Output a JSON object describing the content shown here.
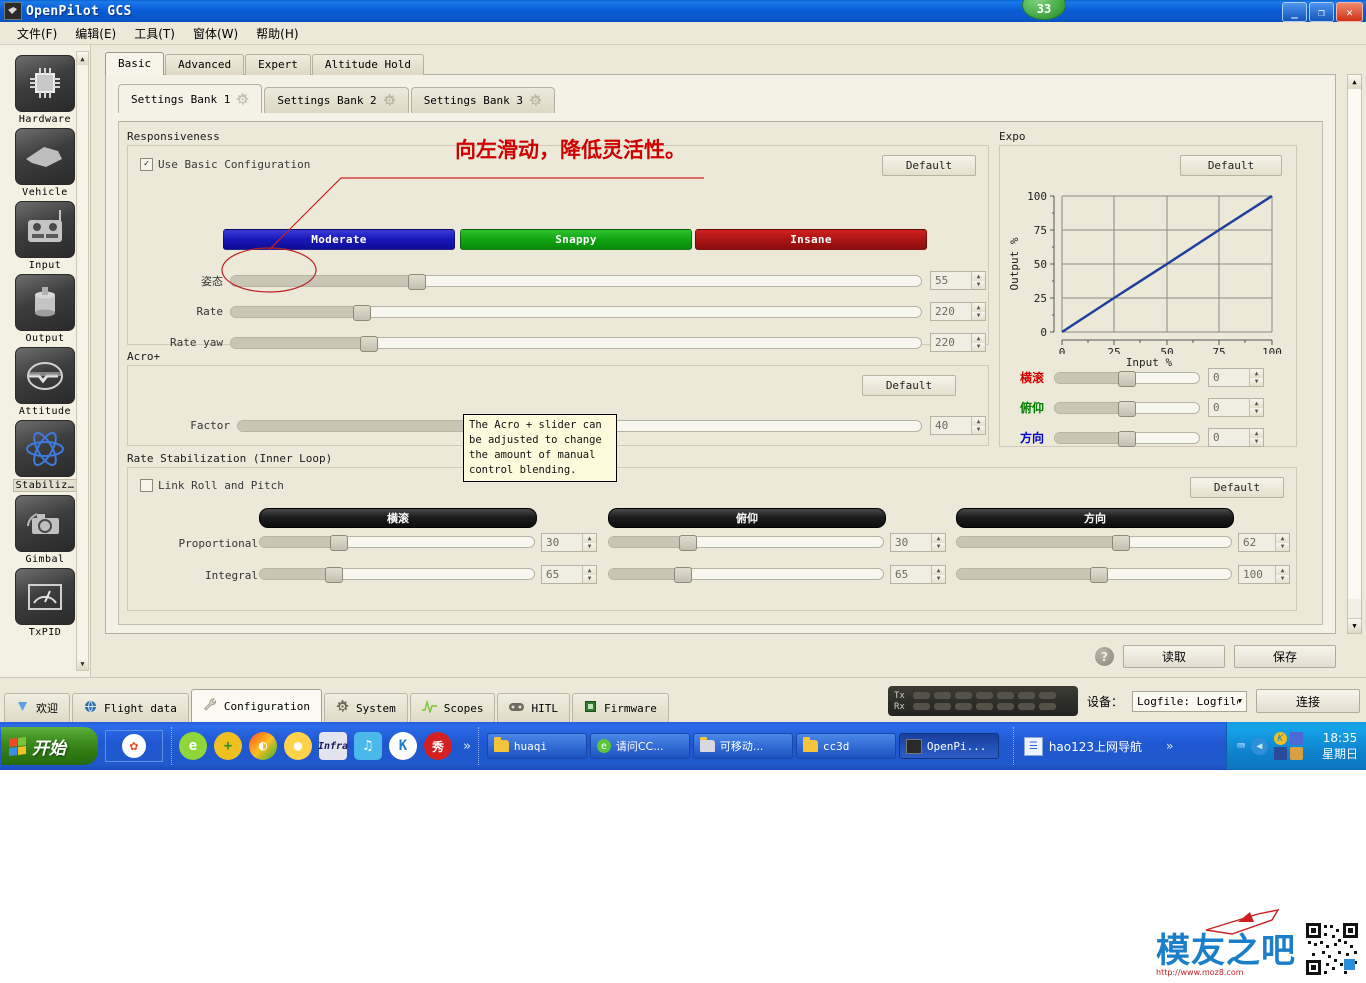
{
  "window": {
    "title": "OpenPilot GCS",
    "badge": "33",
    "buttons": {
      "minimize": "_",
      "maximize": "❐",
      "close": "✕"
    }
  },
  "menubar": [
    {
      "label": "文件(F)",
      "name": "menu-file"
    },
    {
      "label": "编辑(E)",
      "name": "menu-edit"
    },
    {
      "label": "工具(T)",
      "name": "menu-tools"
    },
    {
      "label": "窗体(W)",
      "name": "menu-window"
    },
    {
      "label": "帮助(H)",
      "name": "menu-help"
    }
  ],
  "sidebar": {
    "items": [
      {
        "label": "Hardware",
        "icon": "chip-icon"
      },
      {
        "label": "Vehicle",
        "icon": "airframe-icon"
      },
      {
        "label": "Input",
        "icon": "transmitter-icon"
      },
      {
        "label": "Output",
        "icon": "motor-icon"
      },
      {
        "label": "Attitude",
        "icon": "level-icon"
      },
      {
        "label": "Stabiliz…",
        "icon": "gyro-icon",
        "selected": true
      },
      {
        "label": "Gimbal",
        "icon": "camera-icon"
      },
      {
        "label": "TxPID",
        "icon": "gauge-icon"
      }
    ]
  },
  "tabs": {
    "top": [
      {
        "label": "Basic",
        "active": true
      },
      {
        "label": "Advanced",
        "active": false
      },
      {
        "label": "Expert",
        "active": false
      },
      {
        "label": "Altitude Hold",
        "active": false
      }
    ],
    "banks": [
      {
        "label": "Settings Bank 1",
        "active": true
      },
      {
        "label": "Settings Bank 2",
        "active": false
      },
      {
        "label": "Settings Bank 3",
        "active": false
      }
    ]
  },
  "responsiveness": {
    "group_title": "Responsiveness",
    "checkbox_label": "Use Basic Configuration",
    "checkbox_checked": true,
    "default_label": "Default",
    "presets": [
      {
        "label": "Moderate",
        "color": "#1717b8"
      },
      {
        "label": "Snappy",
        "color": "#11a511"
      },
      {
        "label": "Insane",
        "color": "#ab1414"
      }
    ],
    "sliders": [
      {
        "label": "姿态",
        "value": "55",
        "pct": 27
      },
      {
        "label": "Rate",
        "value": "220",
        "pct": 19
      },
      {
        "label": "Rate yaw",
        "value": "220",
        "pct": 20
      }
    ]
  },
  "acro": {
    "group_title": "Acro+",
    "default_label": "Default",
    "slider": {
      "label": "Factor",
      "value": "40",
      "pct": 40
    },
    "tooltip": "The Acro + slider can be adjusted to change the amount of manual control blending."
  },
  "rate_stab": {
    "group_title": "Rate Stabilization (Inner Loop)",
    "link_label": "Link Roll and Pitch",
    "link_checked": false,
    "default_label": "Default",
    "axes": [
      {
        "header": "横滚",
        "proportional": "30",
        "p_pct": 29,
        "integral": "65",
        "i_pct": 27
      },
      {
        "header": "俯仰",
        "proportional": "30",
        "p_pct": 29,
        "integral": "65",
        "i_pct": 27
      },
      {
        "header": "方向",
        "proportional": "62",
        "p_pct": 60,
        "integral": "100",
        "i_pct": 52
      }
    ],
    "row_labels": {
      "proportional": "Proportional",
      "integral": "Integral"
    }
  },
  "expo": {
    "group_title": "Expo",
    "default_label": "Default",
    "sliders": [
      {
        "label": "横滚",
        "color": "#cc0000",
        "value": "0",
        "pct": 50
      },
      {
        "label": "俯仰",
        "color": "#008000",
        "value": "0",
        "pct": 50
      },
      {
        "label": "方向",
        "color": "#0000cc",
        "value": "0",
        "pct": 50
      }
    ]
  },
  "chart_data": {
    "type": "line",
    "title": "Expo",
    "xlabel": "Input %",
    "ylabel": "Output %",
    "xlim": [
      0,
      100
    ],
    "ylim": [
      0,
      100
    ],
    "xticks": [
      "0",
      "25",
      "50",
      "75",
      "100"
    ],
    "yticks": [
      "0",
      "25",
      "50",
      "75",
      "100"
    ],
    "grid": true,
    "legend": "none",
    "series": [
      {
        "name": "expo-curve",
        "color": "#1f3fa0",
        "x": [
          0,
          25,
          50,
          75,
          100
        ],
        "y": [
          0,
          25,
          50,
          75,
          100
        ]
      }
    ]
  },
  "annotation": {
    "text": "向左滑动，降低灵活性。",
    "color": "#cc0000"
  },
  "actions": {
    "help": "?",
    "read_label": "读取",
    "save_label": "保存"
  },
  "bottom_nav": [
    {
      "label": "欢迎",
      "icon": "welcome-icon",
      "active": false
    },
    {
      "label": "Flight data",
      "icon": "globe-icon",
      "active": false
    },
    {
      "label": "Configuration",
      "icon": "wrench-icon",
      "active": true
    },
    {
      "label": "System",
      "icon": "gears-icon",
      "active": false
    },
    {
      "label": "Scopes",
      "icon": "waveform-icon",
      "active": false
    },
    {
      "label": "HITL",
      "icon": "gamepad-icon",
      "active": false
    },
    {
      "label": "Firmware",
      "icon": "chip-icon",
      "active": false
    }
  ],
  "status": {
    "tx_label": "Tx",
    "rx_label": "Rx",
    "device_label": "设备：",
    "device_value": "Logfile: Logfile",
    "connect_label": "连接"
  },
  "taskbar": {
    "start_label": "开始",
    "quick_launch": [
      {
        "name": "pinwheel-icon",
        "glyph": "✿",
        "color": "#e04a1a",
        "bg": "#ffffff"
      }
    ],
    "quick_icons": [
      {
        "name": "ie-icon",
        "glyph": "e",
        "bg": "#8fd63a",
        "fg": "#ffffff"
      },
      {
        "name": "plus-shield-icon",
        "glyph": "+",
        "bg": "#f0c020",
        "fg": "#2f8f2f"
      },
      {
        "name": "360-icon",
        "glyph": "◔",
        "bg": "#ff7a1a",
        "fg": "#ffffff"
      },
      {
        "name": "qq-chat-icon",
        "glyph": "●",
        "bg": "#ffd24a",
        "fg": "#ffffff"
      },
      {
        "name": "infrarecorder-icon",
        "glyph": "I",
        "bg": "#d8d8e8",
        "fg": "#1a1a5a"
      },
      {
        "name": "kugou-icon",
        "glyph": "♪",
        "bg": "#4ab8ea",
        "fg": "#ffffff"
      },
      {
        "name": "kingsoft-icon",
        "glyph": "K",
        "bg": "#ffffff",
        "fg": "#1a7ec8"
      },
      {
        "name": "meitu-icon",
        "glyph": "秀",
        "bg": "#d42020",
        "fg": "#ffffff"
      }
    ],
    "overflow": "»",
    "windows": [
      {
        "label": "huaqi",
        "icon": "folder-icon",
        "active": false
      },
      {
        "label": "请问CC...",
        "icon": "ie-icon",
        "active": false
      },
      {
        "label": "可移动...",
        "icon": "folder-icon",
        "active": false
      },
      {
        "label": "cc3d",
        "icon": "folder-icon",
        "active": false
      },
      {
        "label": "OpenPi...",
        "icon": "openpilot-icon",
        "active": true
      }
    ],
    "deskband": {
      "label": "hao123上网导航",
      "overflow": "»"
    },
    "tray": {
      "icons": [
        "keyboard-icon",
        "chevron-left-icon",
        "kingsoft-icon",
        "network-icon",
        "volume-icon",
        "usb-icon"
      ],
      "time": "18:35",
      "day": "星期日"
    }
  },
  "watermark": {
    "text": "模友之吧",
    "url": "http://www.moz8.com"
  }
}
